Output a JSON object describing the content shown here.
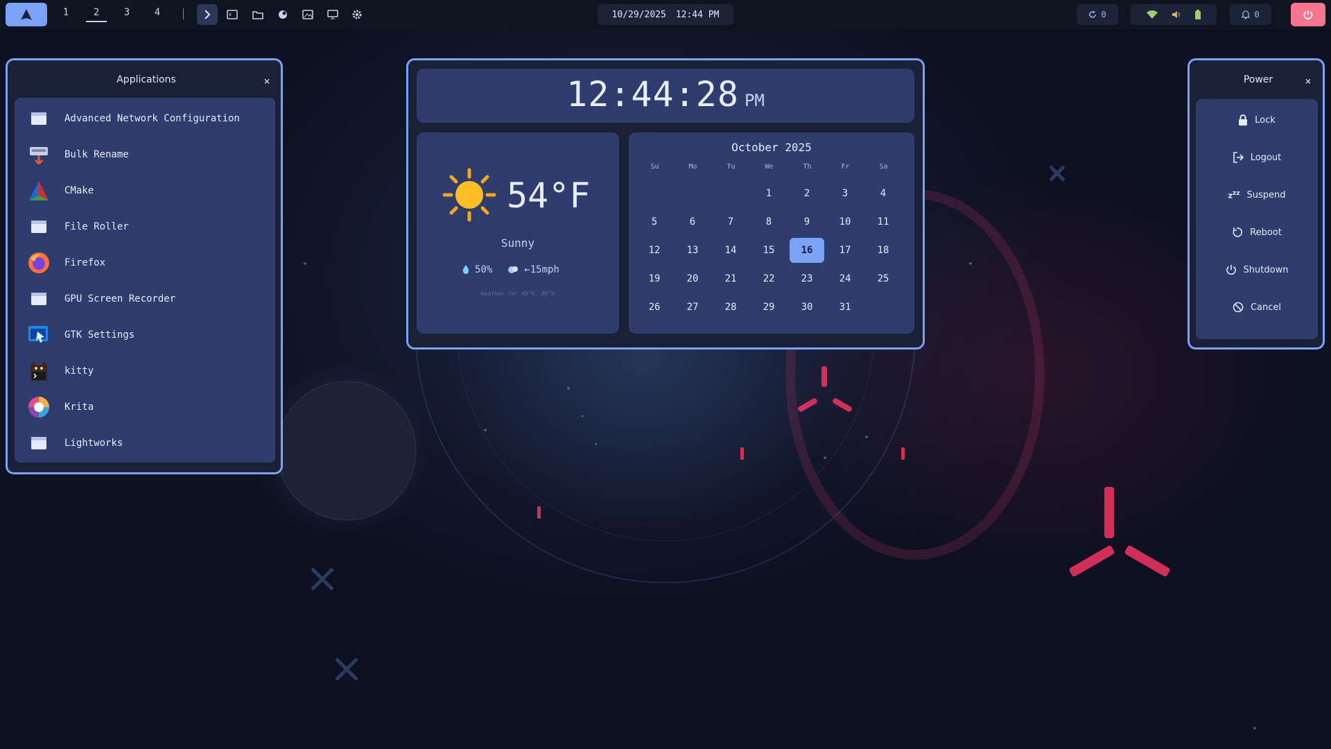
{
  "topbar": {
    "workspaces": [
      "1",
      "2",
      "3",
      "4"
    ],
    "active_workspace": "2",
    "date": "10/29/2025",
    "time": "12:44 PM",
    "updates_count": "0",
    "notifications_count": "0",
    "accent": "#7aa2f7",
    "power_color": "#f7768e"
  },
  "applications": {
    "title": "Applications",
    "close": "×",
    "items": [
      {
        "label": "Advanced Network Configuration",
        "icon": "window-icon"
      },
      {
        "label": "Bulk Rename",
        "icon": "bulk-rename-icon"
      },
      {
        "label": "CMake",
        "icon": "cmake-icon"
      },
      {
        "label": "File Roller",
        "icon": "window-icon"
      },
      {
        "label": "Firefox",
        "icon": "firefox-icon"
      },
      {
        "label": "GPU Screen Recorder",
        "icon": "window-icon"
      },
      {
        "label": "GTK Settings",
        "icon": "gtk-settings-icon"
      },
      {
        "label": "kitty",
        "icon": "kitty-icon"
      },
      {
        "label": "Krita",
        "icon": "krita-icon"
      },
      {
        "label": "Lightworks",
        "icon": "window-icon"
      }
    ]
  },
  "clock": {
    "time": "12:44:28",
    "ampm": "PM"
  },
  "weather": {
    "temperature": "54°F",
    "condition": "Sunny",
    "humidity": "50%",
    "wind": "←15mph",
    "location": "Weather for 40°N, 80°W"
  },
  "calendar": {
    "title": "October 2025",
    "weekdays": [
      "Su",
      "Mo",
      "Tu",
      "We",
      "Th",
      "Fr",
      "Sa"
    ],
    "first_weekday_index": 3,
    "days_in_month": 31,
    "today": 16
  },
  "power": {
    "title": "Power",
    "close": "×",
    "items": [
      {
        "label": "Lock",
        "icon": "lock-icon"
      },
      {
        "label": "Logout",
        "icon": "logout-icon"
      },
      {
        "label": "Suspend",
        "icon": "suspend-icon"
      },
      {
        "label": "Reboot",
        "icon": "reboot-icon"
      },
      {
        "label": "Shutdown",
        "icon": "shutdown-icon"
      },
      {
        "label": "Cancel",
        "icon": "cancel-icon"
      }
    ]
  }
}
